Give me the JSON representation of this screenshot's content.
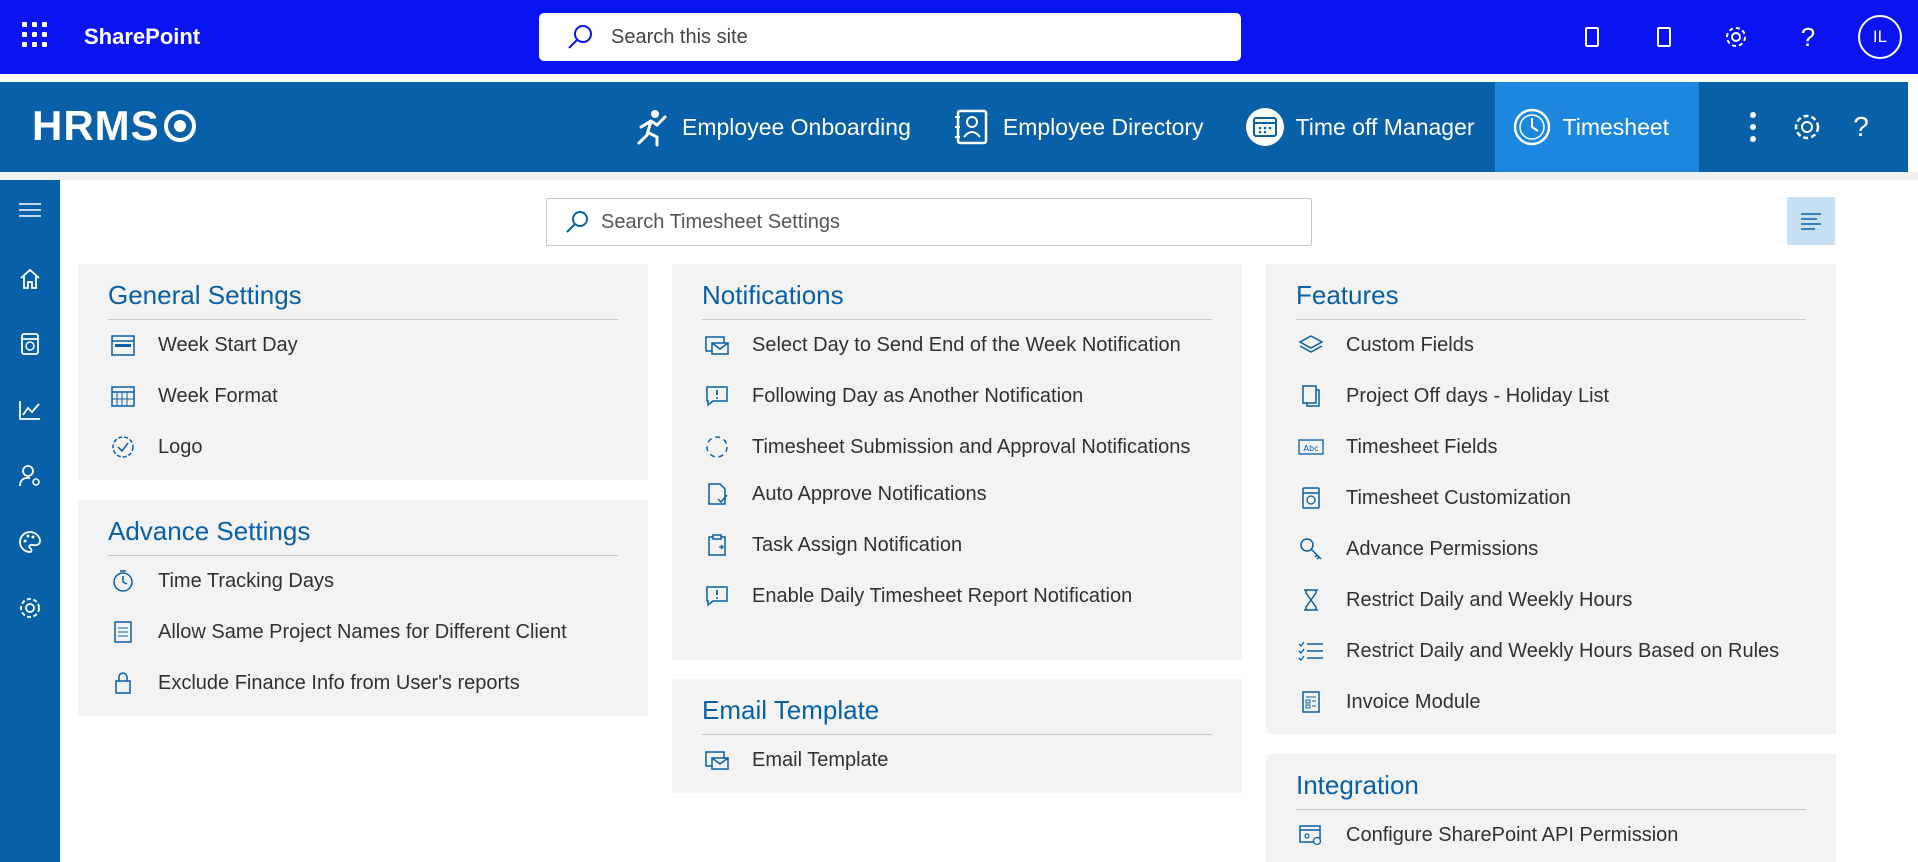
{
  "suitebar": {
    "title": "SharePoint",
    "search_placeholder": "Search this site",
    "avatar_initials": "IL"
  },
  "app": {
    "logo": "HRMS",
    "nav": [
      {
        "label": "Employee Onboarding",
        "icon": "onboarding-icon"
      },
      {
        "label": "Employee Directory",
        "icon": "directory-icon"
      },
      {
        "label": "Time off Manager",
        "icon": "calendar-icon"
      },
      {
        "label": "Timesheet",
        "icon": "clock-icon",
        "active": true
      }
    ]
  },
  "rail": [
    "menu-icon",
    "home-icon",
    "timesheet-icon",
    "chart-icon",
    "user-settings-icon",
    "palette-icon",
    "gear-icon"
  ],
  "settings_search": {
    "placeholder": "Search Timesheet Settings"
  },
  "cards": {
    "general": {
      "title": "General Settings",
      "items": [
        "Week Start Day",
        "Week Format",
        "Logo"
      ]
    },
    "advance": {
      "title": "Advance Settings",
      "items": [
        "Time Tracking Days",
        "Allow Same Project Names for Different Client",
        "Exclude Finance Info from User's reports"
      ]
    },
    "notifications": {
      "title": "Notifications",
      "items": [
        "Select Day to Send End of the Week Notification",
        "Following Day as Another Notification",
        "Timesheet Submission and Approval Notifications",
        "Auto Approve Notifications",
        "Task Assign Notification",
        "Enable Daily Timesheet Report Notification"
      ]
    },
    "email": {
      "title": "Email Template",
      "items": [
        "Email Template"
      ]
    },
    "features": {
      "title": "Features",
      "items": [
        "Custom Fields",
        "Project Off days - Holiday List",
        "Timesheet Fields",
        "Timesheet Customization",
        "Advance Permissions",
        "Restrict Daily and Weekly Hours",
        "Restrict Daily and Weekly Hours Based on Rules",
        "Invoice Module"
      ]
    },
    "integration": {
      "title": "Integration",
      "items": [
        "Configure SharePoint API Permission"
      ]
    }
  },
  "colors": {
    "suitebar": "#0a14f0",
    "appbar": "#0860a8",
    "active_tab": "#1b87df",
    "card_title": "#0860a8",
    "card_bg": "#f3f3f3"
  }
}
